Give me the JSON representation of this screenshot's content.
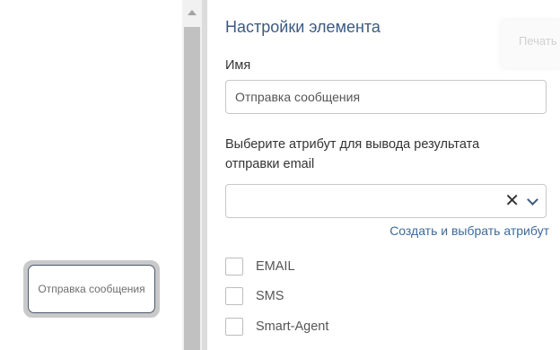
{
  "canvas": {
    "node_label": "Отправка сообщения"
  },
  "panel": {
    "title": "Настройки элемента",
    "print_tab_label": "Печать",
    "name_label": "Имя",
    "name_value": "Отправка сообщения",
    "attribute_label": "Выберите атрибут для вывода результата отправки email",
    "attribute_value": "",
    "clear_glyph": "✕",
    "create_link": "Создать и выбрать атрибут",
    "channels": [
      {
        "label": "EMAIL",
        "checked": false
      },
      {
        "label": "SMS",
        "checked": false
      },
      {
        "label": "Smart-Agent",
        "checked": false
      }
    ]
  }
}
